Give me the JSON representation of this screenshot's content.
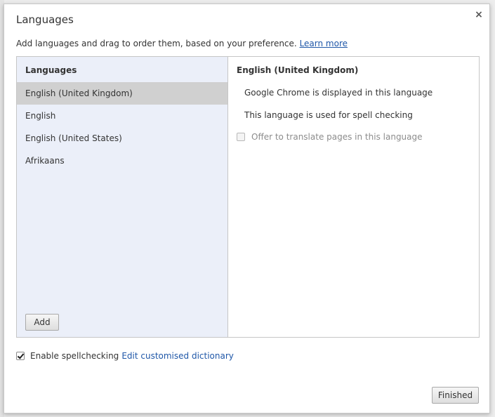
{
  "dialog": {
    "title": "Languages",
    "close_icon": "close-icon",
    "close_glyph": "×",
    "description": "Add languages and drag to order them, based on your preference.",
    "learn_more": "Learn more"
  },
  "languages_pane": {
    "header": "Languages",
    "items": [
      {
        "label": "English (United Kingdom)",
        "selected": true
      },
      {
        "label": "English",
        "selected": false
      },
      {
        "label": "English (United States)",
        "selected": false
      },
      {
        "label": "Afrikaans",
        "selected": false
      }
    ],
    "add_label": "Add"
  },
  "detail_pane": {
    "header": "English (United Kingdom)",
    "display_info": "Google Chrome is displayed in this language",
    "spell_info": "This language is used for spell checking",
    "translate_label": "Offer to translate pages in this language",
    "translate_checked": false
  },
  "spellcheck": {
    "label": "Enable spellchecking",
    "checked": true,
    "link": "Edit customised dictionary"
  },
  "footer": {
    "finished_label": "Finished"
  },
  "colors": {
    "link": "#1f57a8",
    "left_pane_bg": "#ebeff9",
    "selected_row": "#d0d0d0"
  }
}
